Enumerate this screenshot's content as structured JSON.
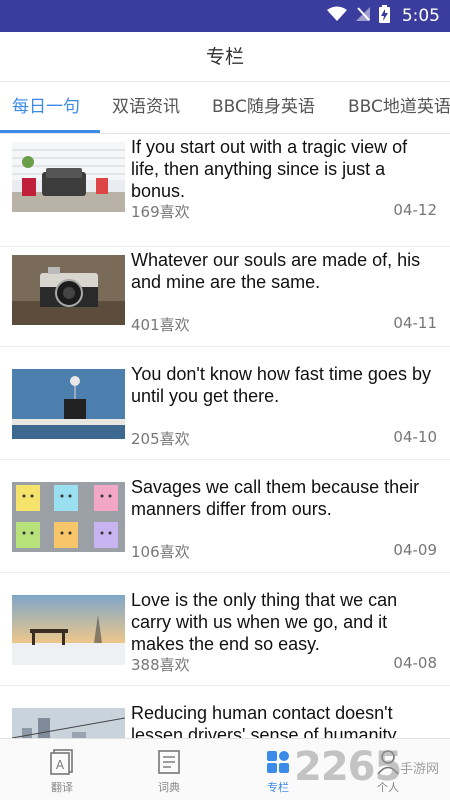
{
  "status_bar": {
    "time": "5:05"
  },
  "header": {
    "title": "专栏"
  },
  "tabs": [
    {
      "label": "每日一句",
      "active": true
    },
    {
      "label": "双语资讯",
      "active": false
    },
    {
      "label": "BBC随身英语",
      "active": false
    },
    {
      "label": "BBC地道英语",
      "active": false
    }
  ],
  "items": [
    {
      "quote": "If you start out with a tragic view of life, then anything since is just a bonus.",
      "likes": "169喜欢",
      "date": "04-12",
      "image": "patio-chairs"
    },
    {
      "quote": "Whatever our souls are made of, his and mine are the same.",
      "likes": "401喜欢",
      "date": "04-11",
      "image": "vintage-camera"
    },
    {
      "quote": "You don't know how fast time goes by until you get there.",
      "likes": "205喜欢",
      "date": "04-10",
      "image": "plant-pot-shelf"
    },
    {
      "quote": "Savages we call them because their manners differ from ours.",
      "likes": "106喜欢",
      "date": "04-09",
      "image": "sticky-note-faces"
    },
    {
      "quote": "Love is the only thing that we can carry with us when we go, and it makes the end so easy.",
      "likes": "388喜欢",
      "date": "04-08",
      "image": "winter-bench"
    },
    {
      "quote": "Reducing human contact doesn't lessen drivers' sense of humanity",
      "likes": "",
      "date": "",
      "image": "city-skyline"
    }
  ],
  "bottom_nav": [
    {
      "label": "翻译",
      "icon": "translate-icon",
      "active": false
    },
    {
      "label": "词典",
      "icon": "dictionary-icon",
      "active": false
    },
    {
      "label": "专栏",
      "icon": "column-icon",
      "active": true
    },
    {
      "label": "个人",
      "icon": "person-icon",
      "active": false
    }
  ],
  "watermark": {
    "brand": "2265",
    "site": "手游网"
  },
  "colors": {
    "status_bar": "#3b3d9e",
    "accent": "#3d8be8"
  }
}
